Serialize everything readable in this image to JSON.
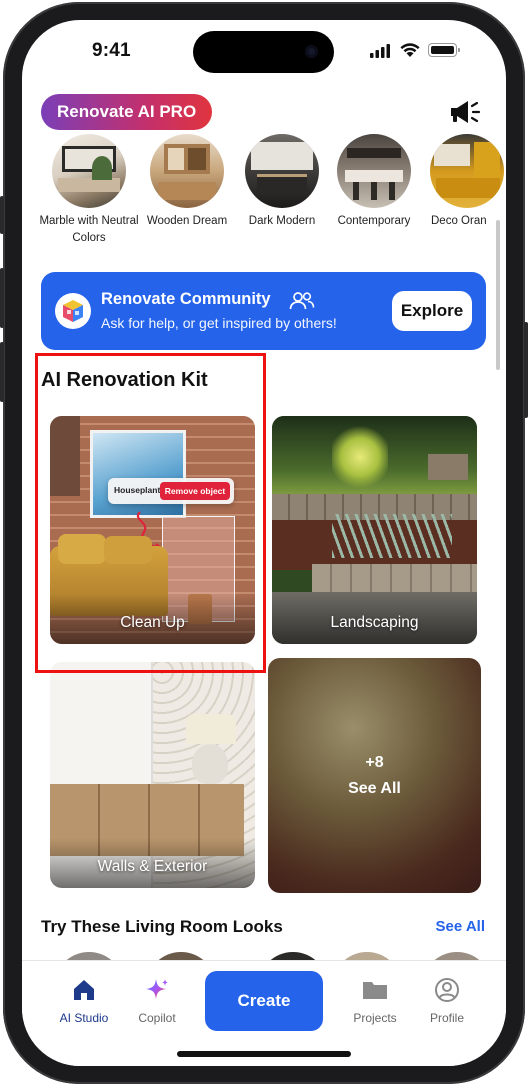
{
  "status_bar": {
    "time": "9:41"
  },
  "header": {
    "pro_label": "Renovate AI PRO",
    "announce_icon": "megaphone-icon"
  },
  "styles": [
    {
      "label": "Marble with Neutral Colors"
    },
    {
      "label": "Wooden Dream"
    },
    {
      "label": "Dark Modern"
    },
    {
      "label": "Contemporary"
    },
    {
      "label": "Deco Oran"
    }
  ],
  "community": {
    "title": "Renovate Community",
    "subtitle": "Ask for help, or get inspired by others!",
    "button": "Explore",
    "title_icon": "people-icon",
    "logo_icon": "cube-logo-icon"
  },
  "kit": {
    "title": "AI Renovation Kit",
    "tiles": [
      {
        "label": "Clean Up",
        "chip_left": "Houseplant",
        "chip_right": "Remove object"
      },
      {
        "label": "Landscaping"
      },
      {
        "label": "Walls & Exterior"
      },
      {
        "label": "See All",
        "count": "+8"
      }
    ]
  },
  "looks": {
    "title": "Try These Living Room Looks",
    "see_all": "See All"
  },
  "tabbar": {
    "items": [
      {
        "label": "AI Studio",
        "icon": "home-icon",
        "active": true
      },
      {
        "label": "Copilot",
        "icon": "sparkle-icon"
      },
      {
        "label": "Projects",
        "icon": "folder-icon"
      },
      {
        "label": "Profile",
        "icon": "profile-icon"
      }
    ],
    "create_label": "Create"
  },
  "colors": {
    "accent": "#2563eb",
    "highlight": "#e11111",
    "active_tab": "#1e3a8a"
  }
}
